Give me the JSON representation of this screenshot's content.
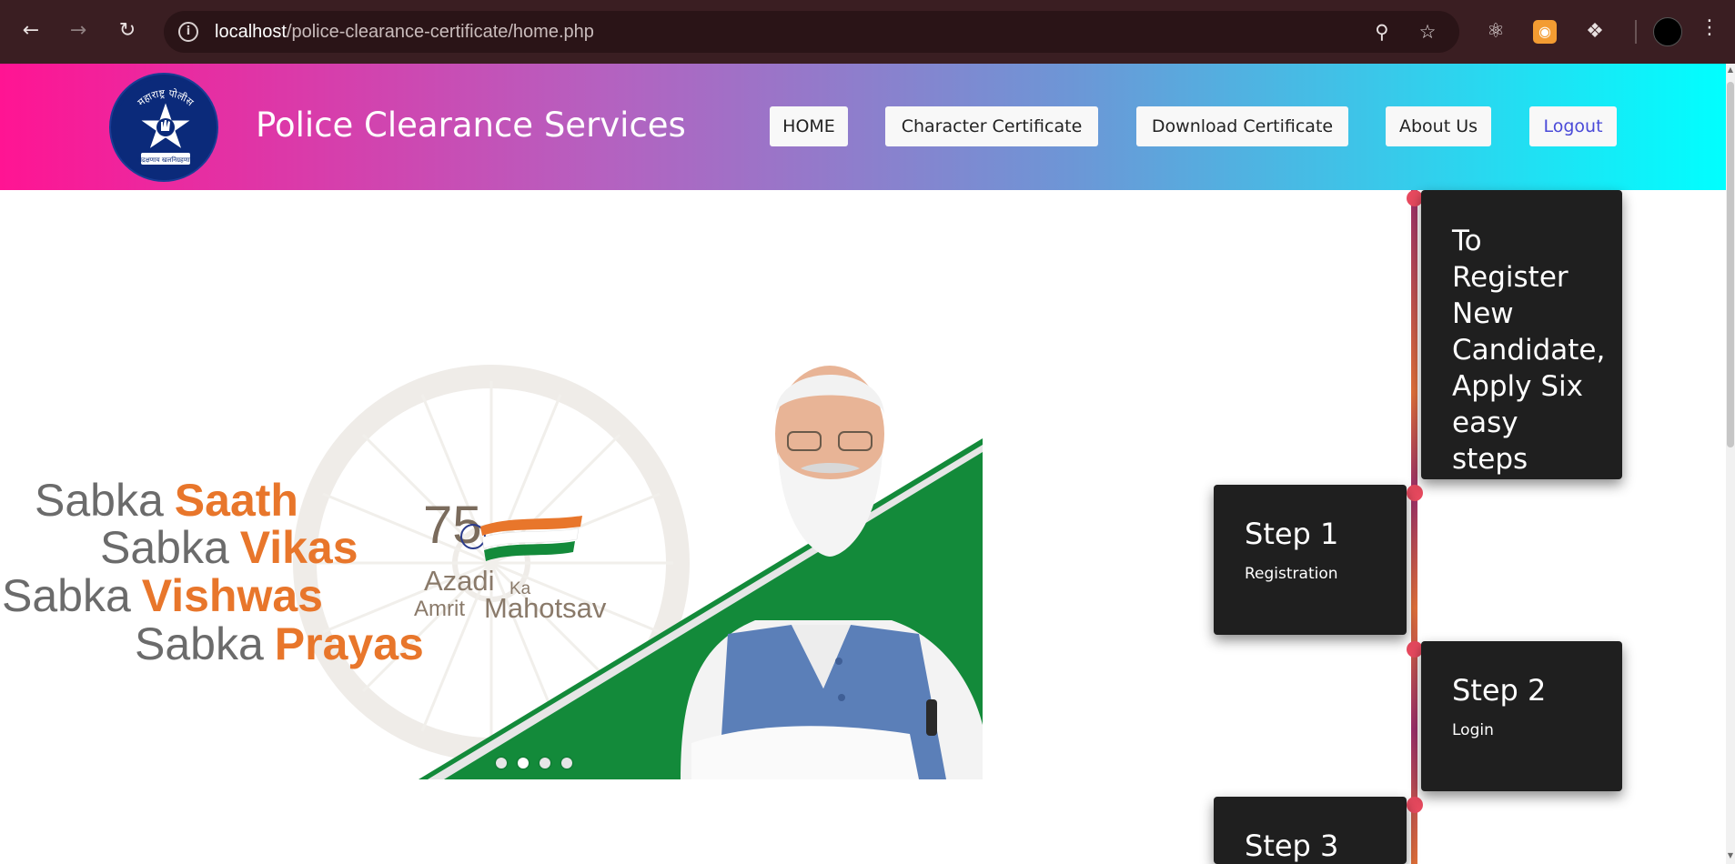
{
  "browser": {
    "url_host": "localhost",
    "url_path": "/police-clearance-certificate/home.php",
    "back_icon": "arrow-left-icon",
    "forward_icon": "arrow-right-icon",
    "reload_icon": "reload-icon",
    "info_icon": "info-icon",
    "zoom_icon": "zoom-icon",
    "bookmark_icon": "star-icon",
    "menu_icon": "kebab-menu-icon"
  },
  "header": {
    "logo_text_top": "महाराष्ट्र पोलीस",
    "logo_text_bottom": "सद्रक्षणाय खलनिग्रहणाय",
    "title": "Police Clearance Services",
    "nav": [
      {
        "label": "HOME"
      },
      {
        "label": "Character Certificate"
      },
      {
        "label": "Download Certificate"
      },
      {
        "label": "About Us"
      },
      {
        "label": "Logout"
      }
    ]
  },
  "carousel": {
    "slogan": [
      "Sabka",
      "Saath",
      "Sabka",
      "Vikas",
      "Sabka",
      "Vishwas",
      "Sabka",
      "Prayas"
    ],
    "emblem_number": "75",
    "emblem_line1": "Azadi",
    "emblem_ka": "Ka",
    "emblem_line2": "Amrit",
    "emblem_line3": "Mahotsav",
    "slide_count": 4,
    "active_slide": 1
  },
  "timeline": {
    "intro": "To Register New Candidate, Apply Six easy steps",
    "steps": [
      {
        "title": "Step 1",
        "desc": "Registration"
      },
      {
        "title": "Step 2",
        "desc": "Login"
      },
      {
        "title": "Step 3",
        "desc": ""
      }
    ]
  },
  "colors": {
    "header_gradient_start": "#ff1493",
    "header_gradient_end": "#00ffff",
    "card_bg": "#1f1f1f",
    "timeline_dot": "#e84a5f",
    "saffron": "#e8762b",
    "green": "#138a3a"
  }
}
